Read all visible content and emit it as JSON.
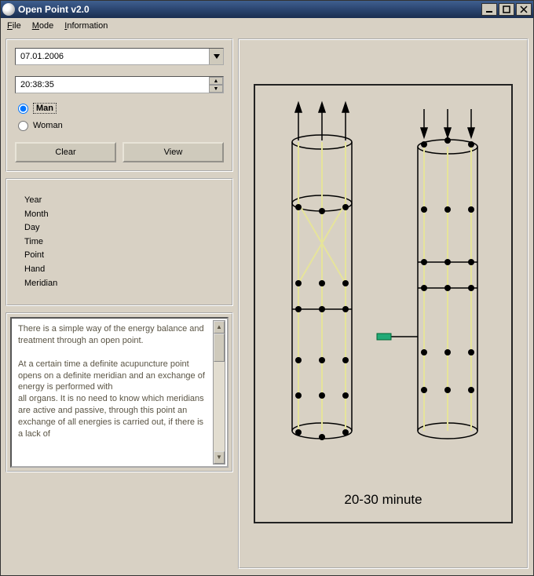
{
  "window": {
    "title": "Open Point v2.0"
  },
  "menu": {
    "file": "File",
    "mode": "Mode",
    "information": "Information"
  },
  "inputs": {
    "date": "07.01.2006",
    "time": "20:38:35",
    "gender_man": "Man",
    "gender_woman": "Woman",
    "selected_gender": "Man"
  },
  "buttons": {
    "clear": "Clear",
    "view": "View"
  },
  "info": {
    "year": "Year",
    "month": "Month",
    "day": "Day",
    "time": "Time",
    "point": "Point",
    "hand": "Hand",
    "meridian": "Meridian"
  },
  "description": "There is a simple way of the energy balance and treatment through an open point.\n\nAt a certain time a definite acupuncture point opens on a definite meridian and an exchange of energy is performed with\nall organs. It is no need to know which meridians are active and passive, through this point an exchange of all energies is carried out, if there is a lack of",
  "diagram": {
    "caption": "20-30 minute"
  }
}
